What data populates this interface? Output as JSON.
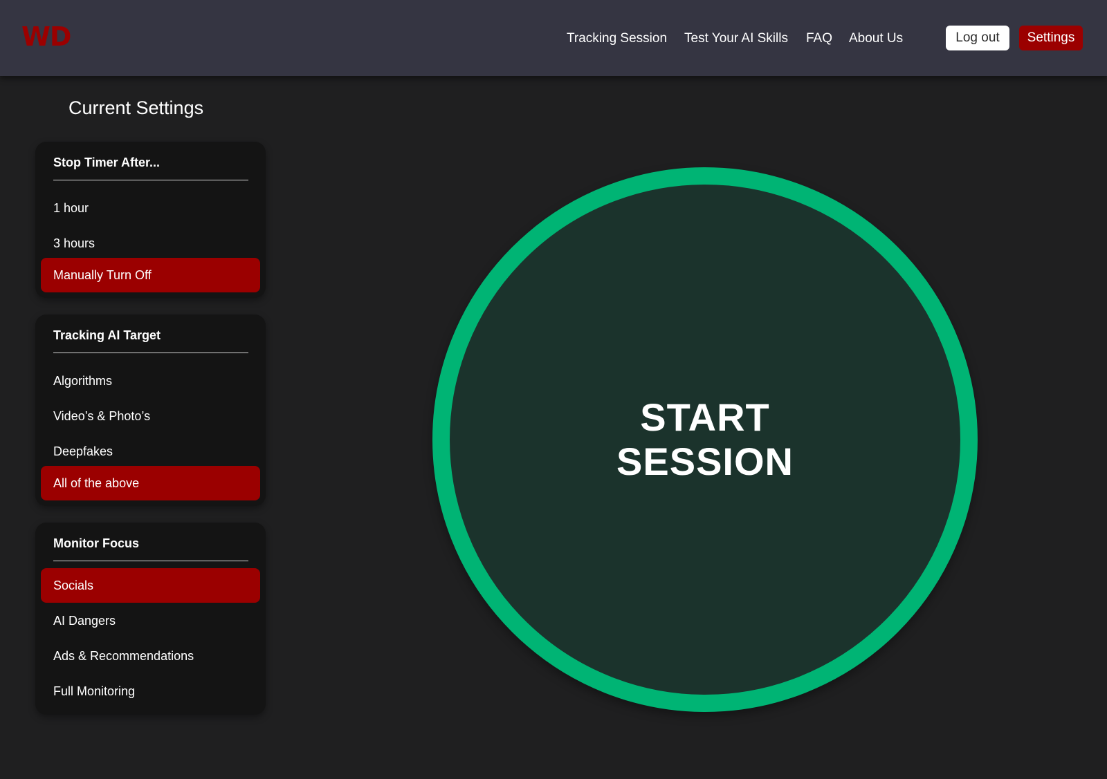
{
  "header": {
    "logo_text": "WD",
    "nav": [
      {
        "label": "Tracking Session"
      },
      {
        "label": "Test Your AI Skills"
      },
      {
        "label": "FAQ"
      },
      {
        "label": "About Us"
      }
    ],
    "logout_label": "Log out",
    "settings_label": "Settings"
  },
  "sidebar": {
    "title": "Current Settings",
    "panels": [
      {
        "heading": "Stop Timer After...",
        "options": [
          {
            "label": "1 hour",
            "selected": false
          },
          {
            "label": "3 hours",
            "selected": false
          },
          {
            "label": "Manually Turn Off",
            "selected": true
          }
        ]
      },
      {
        "heading": "Tracking AI Target",
        "options": [
          {
            "label": "Algorithms",
            "selected": false
          },
          {
            "label": "Video’s & Photo’s",
            "selected": false
          },
          {
            "label": "Deepfakes",
            "selected": false
          },
          {
            "label": "All of the above",
            "selected": true
          }
        ]
      },
      {
        "heading": "Monitor Focus",
        "options": [
          {
            "label": "Socials",
            "selected": true
          },
          {
            "label": "AI Dangers",
            "selected": false
          },
          {
            "label": "Ads & Recommendations",
            "selected": false
          },
          {
            "label": "Full Monitoring",
            "selected": false
          }
        ]
      }
    ]
  },
  "main": {
    "start_line1": "START",
    "start_line2": "SESSION"
  },
  "colors": {
    "header_bg": "#353542",
    "page_bg": "#1f1f20",
    "panel_bg": "#141414",
    "accent_red": "#9b0000",
    "ring_green": "#00b474",
    "circle_fill": "#1b332c"
  }
}
